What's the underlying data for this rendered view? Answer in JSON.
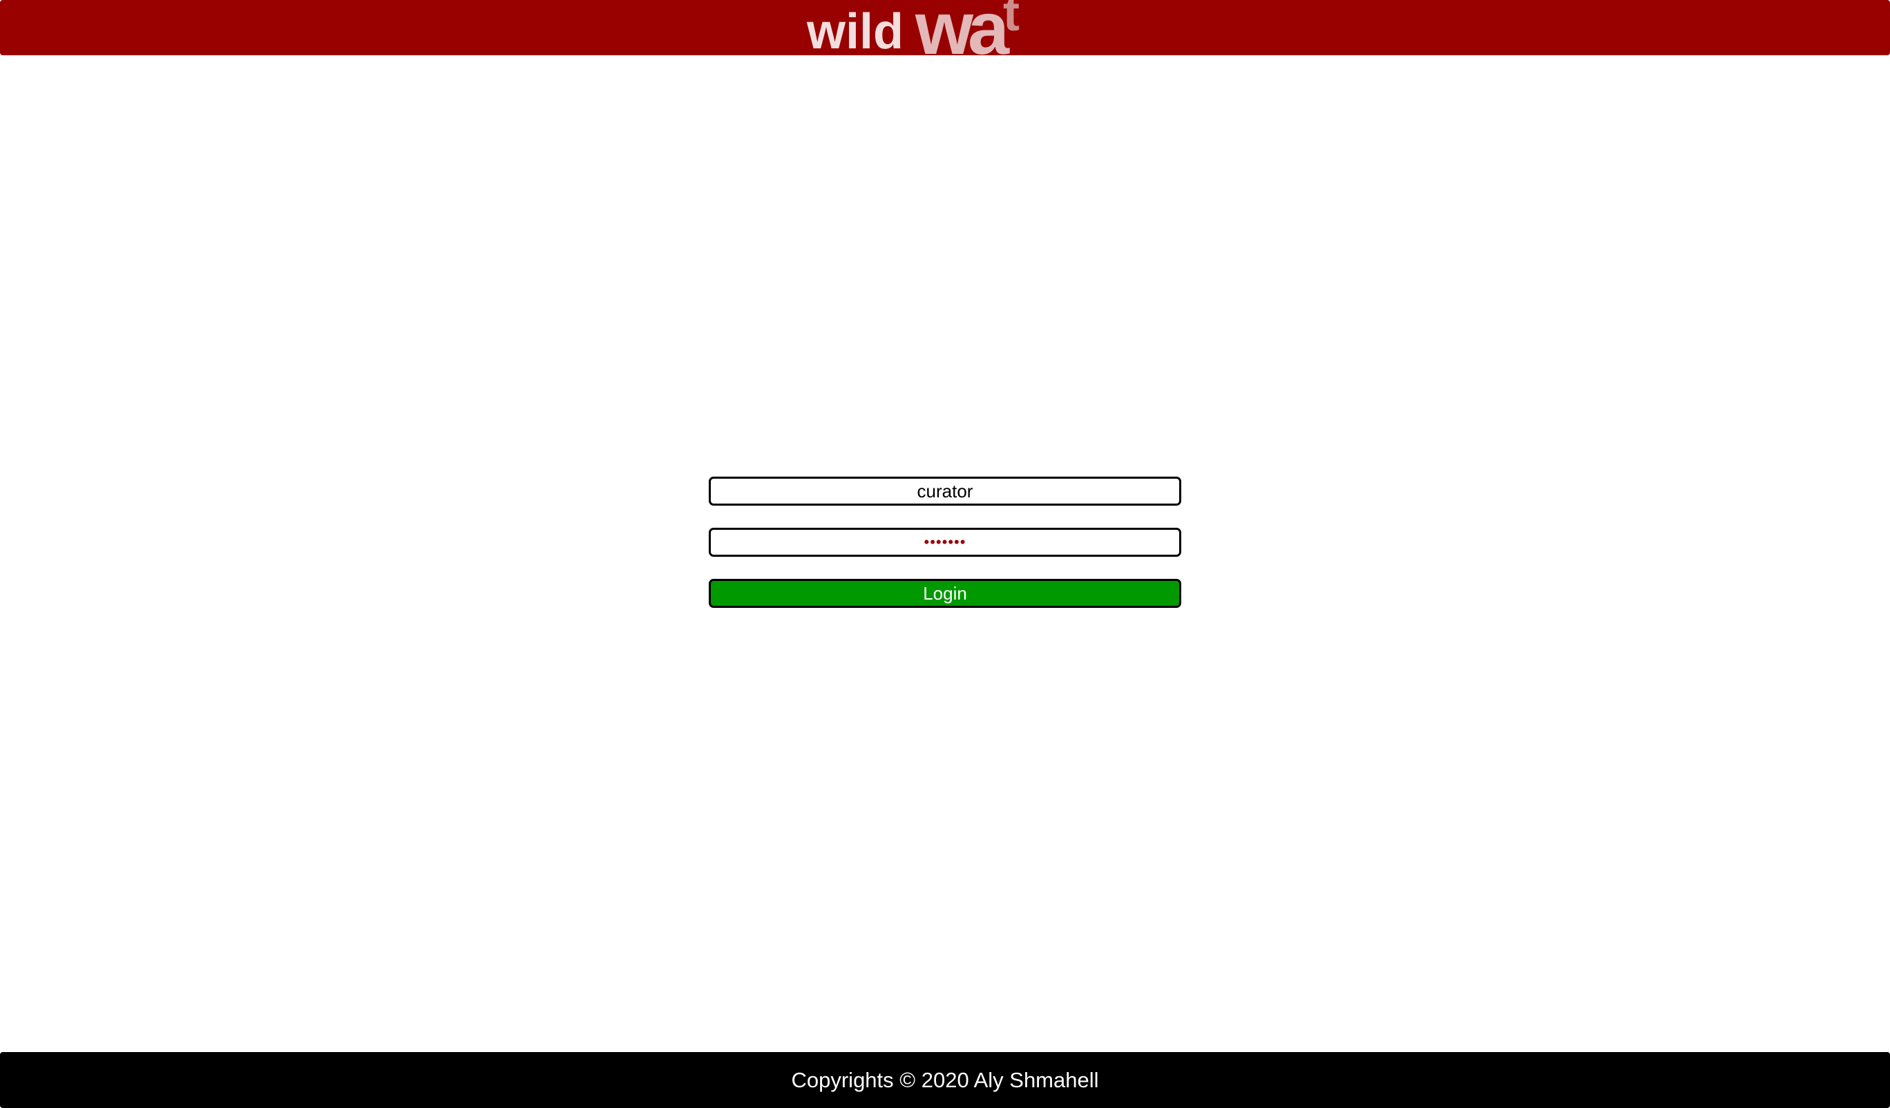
{
  "header": {
    "background_color": "#990000",
    "logo": {
      "text_part1": "wild",
      "text_part2": "wa",
      "text_part3": "t"
    }
  },
  "login": {
    "username_value": "curator",
    "password_value": "•••••••",
    "login_label": "Login",
    "login_button_color": "#009900"
  },
  "footer": {
    "text": "Copyrights © 2020 Aly Shmahell",
    "background_color": "#000000"
  }
}
